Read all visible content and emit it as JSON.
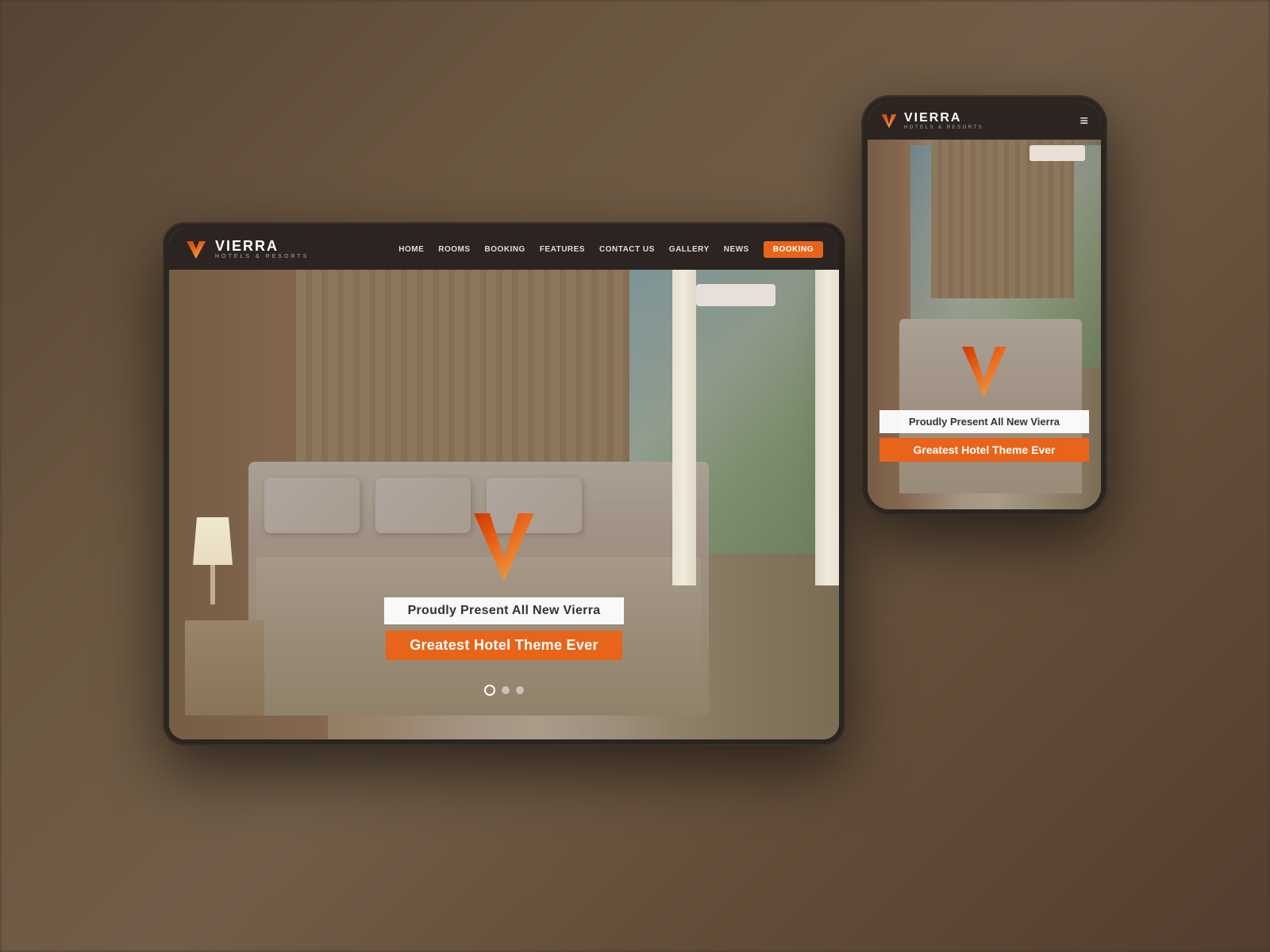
{
  "background": {
    "overlay_color": "rgba(60,45,30,0.65)"
  },
  "tablet": {
    "navbar": {
      "logo_name": "VIERRA",
      "logo_subtitle": "HOTELS & RESORTS",
      "nav_links": [
        "HOME",
        "ROOMS",
        "BOOKING",
        "FEATURES",
        "CONTACT US",
        "GALLERY",
        "NEWS"
      ],
      "booking_button": "BOOKING"
    },
    "hero": {
      "subtitle": "Proudly Present All New Vierra",
      "title": "Greatest Hotel Theme Ever"
    },
    "slider_dots": [
      "active",
      "inactive",
      "inactive"
    ]
  },
  "mobile": {
    "navbar": {
      "logo_name": "VIERRA",
      "logo_subtitle": "HOTELS & RESORTS",
      "menu_icon": "≡"
    },
    "hero": {
      "subtitle": "Proudly Present All New Vierra",
      "title": "Greatest Hotel Theme Ever"
    }
  },
  "colors": {
    "dark_bg": "#2c2420",
    "orange": "#e8641a",
    "white": "#ffffff",
    "light_text": "#dddddd",
    "navbar_bg": "#2c2420"
  }
}
